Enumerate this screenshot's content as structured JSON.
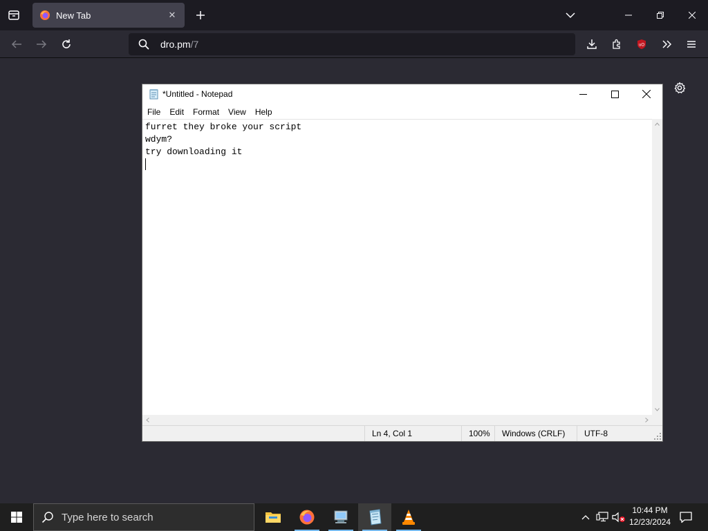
{
  "browser": {
    "tab": {
      "title": "New Tab"
    },
    "url": {
      "host": "dro.pm",
      "path": "/7"
    }
  },
  "notepad": {
    "title": "*Untitled - Notepad",
    "menu": [
      "File",
      "Edit",
      "Format",
      "View",
      "Help"
    ],
    "lines": [
      "furret they broke your script",
      "wdym?",
      "try downloading it",
      ""
    ],
    "status": {
      "position": "Ln 4, Col 1",
      "zoom": "100%",
      "line_endings": "Windows (CRLF)",
      "encoding": "UTF-8"
    }
  },
  "taskbar": {
    "search_placeholder": "Type here to search",
    "apps": [
      "file-explorer-icon",
      "firefox-icon",
      "remote-desktop-icon",
      "notepad-icon",
      "vlc-icon"
    ],
    "clock": {
      "time": "10:44 PM",
      "date": "12/23/2024"
    }
  },
  "colors": {
    "browser_bg": "#2b2a33",
    "tabbar_bg": "#1c1b22",
    "taskbar_bg": "#1f1f1f",
    "accent": "#76b9ed"
  }
}
